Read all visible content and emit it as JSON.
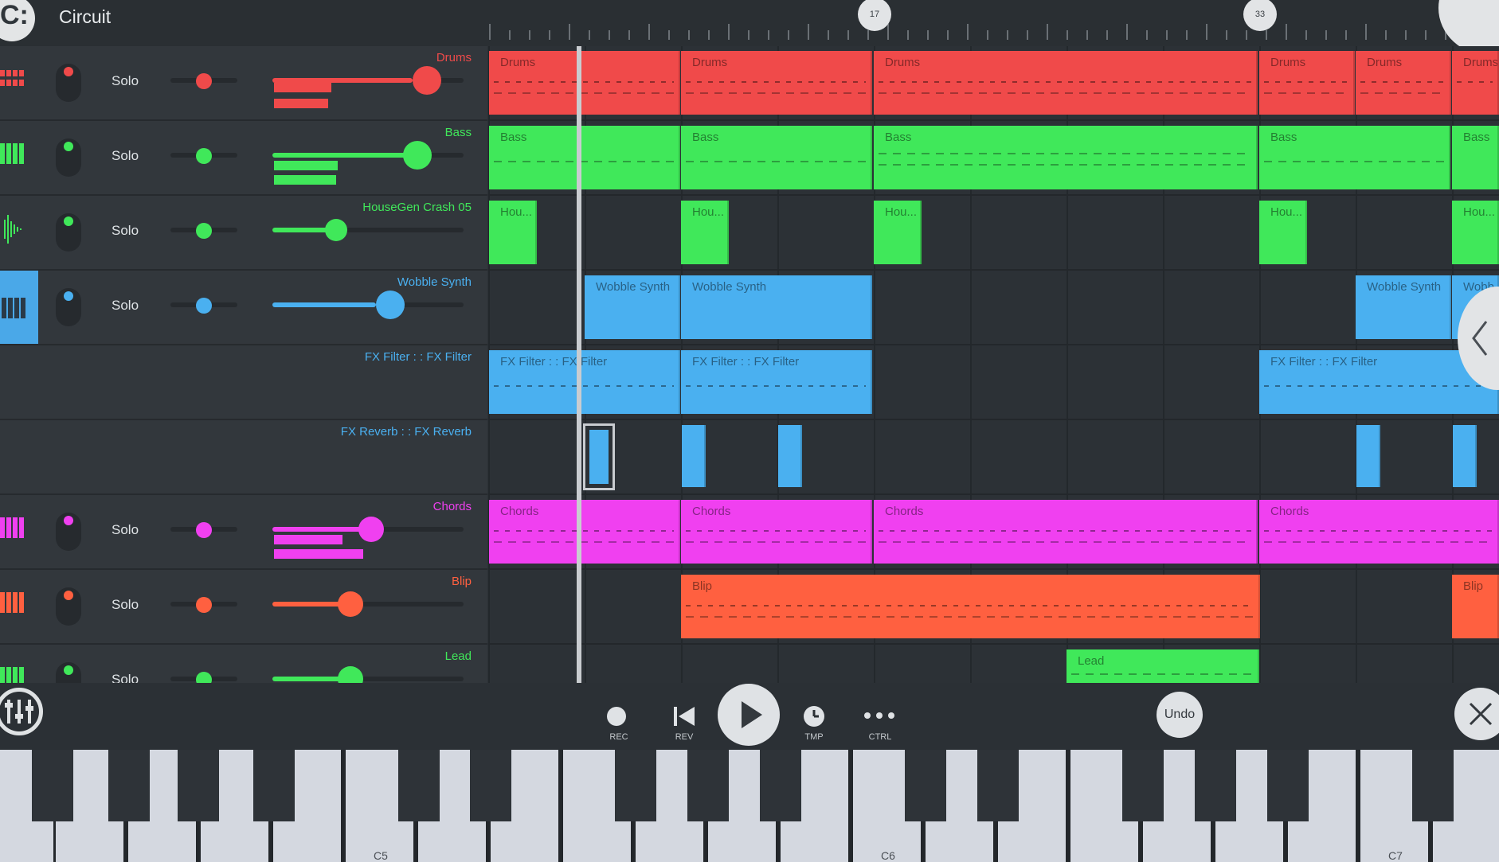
{
  "app": {
    "title": "Circuit",
    "logo_glyph": "C:"
  },
  "ruler": {
    "markers": [
      "17",
      "33"
    ]
  },
  "tracks": [
    {
      "name": "Drums",
      "color": "#f04a4a",
      "solo": "Solo",
      "has_controls": true
    },
    {
      "name": "Bass",
      "color": "#40e85a",
      "solo": "Solo",
      "has_controls": true
    },
    {
      "name": "HouseGen Crash 05",
      "color": "#40e85a",
      "solo": "Solo",
      "has_controls": true
    },
    {
      "name": "Wobble Synth",
      "color": "#4ab0f0",
      "solo": "Solo",
      "has_controls": true
    },
    {
      "name": "FX Filter :  : FX Filter",
      "color": "#4ab0f0",
      "has_controls": false
    },
    {
      "name": "FX Reverb :  : FX Reverb",
      "color": "#4ab0f0",
      "has_controls": false
    },
    {
      "name": "Chords",
      "color": "#f040f0",
      "solo": "Solo",
      "has_controls": true
    },
    {
      "name": "Blip",
      "color": "#ff6040",
      "solo": "Solo",
      "has_controls": true
    },
    {
      "name": "Lead",
      "color": "#40e85a",
      "solo": "Solo",
      "has_controls": true
    }
  ],
  "clips": {
    "drums": [
      "Drums",
      "Drums",
      "Drums",
      "Drums",
      "Drums",
      "Drums"
    ],
    "bass": [
      "Bass",
      "Bass",
      "Bass",
      "Bass",
      "Bass"
    ],
    "crash": [
      "Hou...",
      "Hou...",
      "Hou...",
      "Hou...",
      "Hou..."
    ],
    "wobble": [
      "Wobble Synth",
      "Wobble Synth",
      "Wobble Synth",
      "Wobb"
    ],
    "fxfilter": [
      "FX Filter :  : FX Filter",
      "FX Filter :  : FX Filter",
      "FX Filter :  : FX Filter"
    ],
    "chords": [
      "Chords",
      "Chords",
      "Chords",
      "Chords"
    ],
    "blip": [
      "Blip",
      "Blip"
    ],
    "lead": [
      "Lead"
    ]
  },
  "transport": {
    "rec": "REC",
    "rev": "REV",
    "tmp": "TMP",
    "ctrl": "CTRL",
    "undo": "Undo"
  },
  "keyboard": {
    "labels": [
      "C5",
      "C6",
      "C7"
    ]
  }
}
